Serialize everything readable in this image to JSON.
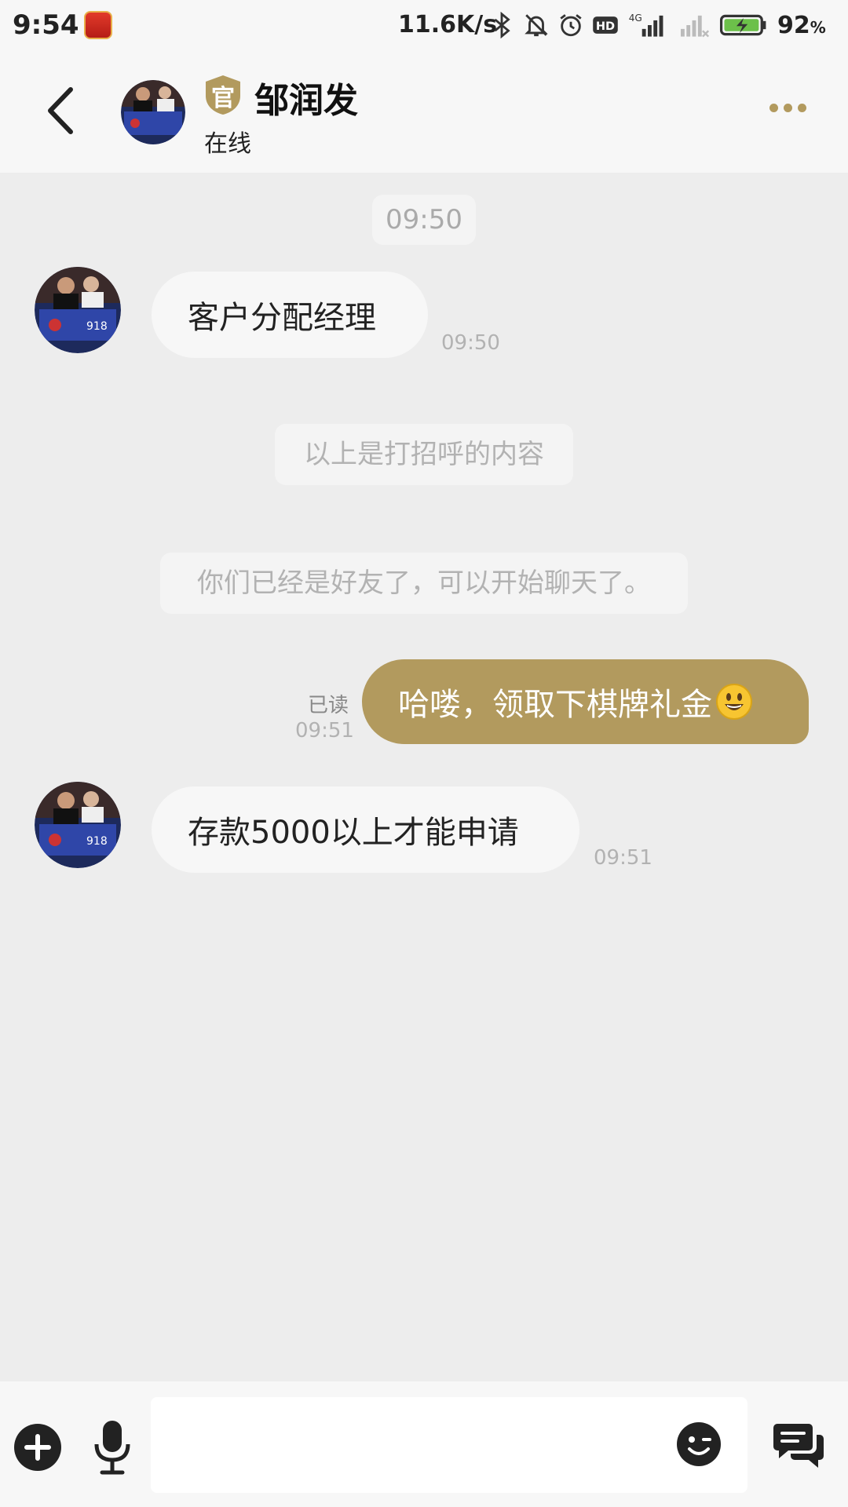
{
  "status_bar": {
    "time": "9:54",
    "net_speed": "11.6K/s",
    "network": "4G",
    "hd_badge": "HD",
    "battery_percent": "92",
    "battery_unit": "%",
    "icons": [
      "app-icon",
      "bluetooth-icon",
      "mute-bell-icon",
      "alarm-icon",
      "hd-icon",
      "signal-4g-icon",
      "signal-weak-icon",
      "battery-charging-icon"
    ]
  },
  "header": {
    "badge_label": "官",
    "name": "邹润发",
    "status": "在线",
    "accent_color": "#b29a5e"
  },
  "messages": {
    "time_divider": "09:50",
    "m1": {
      "text": "客户分配经理",
      "time": "09:50"
    },
    "notice_greeting": "以上是打招呼的内容",
    "notice_friends": "你们已经是好友了，可以开始聊天了。",
    "m2": {
      "text": "哈喽，领取下棋牌礼金",
      "emoji": "smiley-emoji",
      "read_label": "已读",
      "time": "09:51"
    },
    "m3": {
      "text": "存款5000以上才能申请",
      "time": "09:51"
    }
  },
  "input": {
    "placeholder": ""
  }
}
